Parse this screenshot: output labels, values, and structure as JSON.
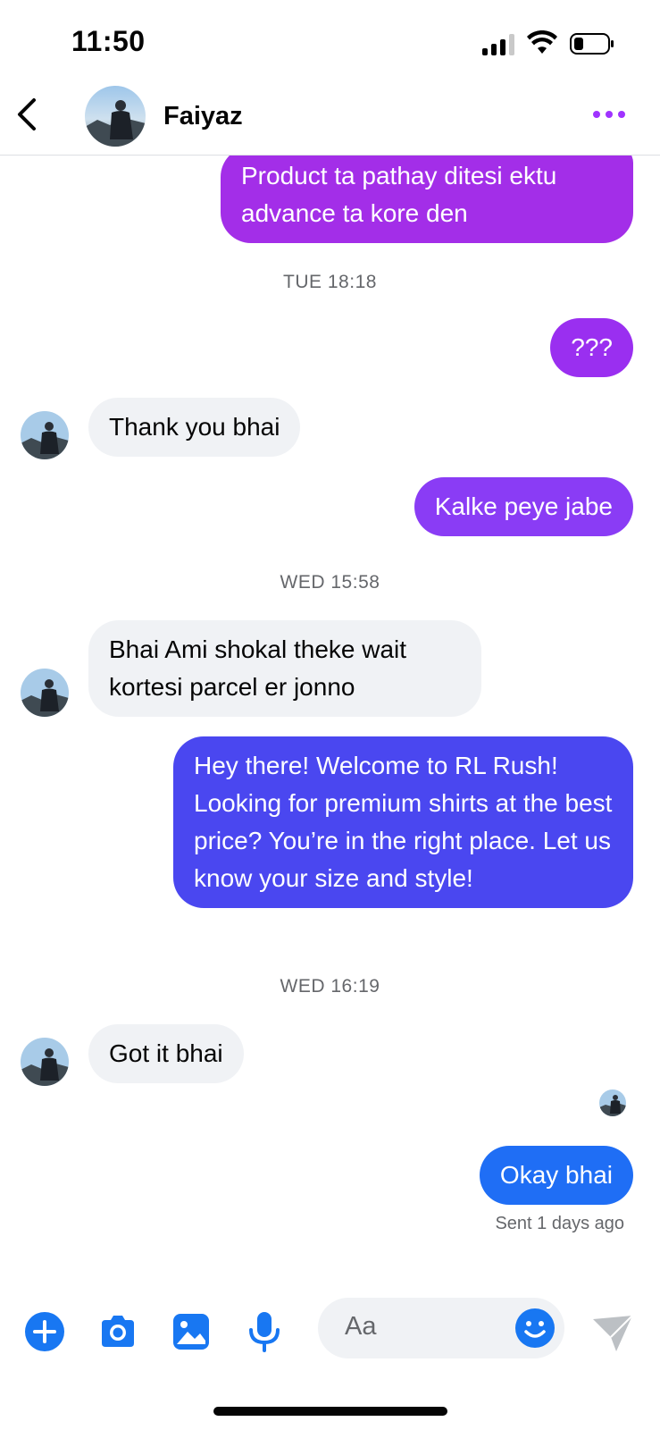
{
  "status_bar": {
    "time": "11:50"
  },
  "header": {
    "contact_name": "Faiyaz"
  },
  "messages": [
    {
      "type": "outgoing",
      "text": "Product ta pathay ditesi ektu advance ta kore den",
      "color": "#a32ee8"
    },
    {
      "type": "timestamp",
      "text": "TUE 18:18"
    },
    {
      "type": "outgoing",
      "text": "???",
      "color": "#9a2ff0"
    },
    {
      "type": "incoming",
      "text": "Thank you bhai"
    },
    {
      "type": "outgoing",
      "text": "Kalke peye jabe",
      "color": "#8a3cf5"
    },
    {
      "type": "timestamp",
      "text": "WED 15:58"
    },
    {
      "type": "incoming",
      "text": "Bhai Ami shokal theke wait kortesi parcel er jonno"
    },
    {
      "type": "outgoing",
      "text": "Hey there! Welcome to RL Rush! Looking for premium shirts at the best price? You’re in the right place. Let us know your size and style!",
      "color": "#4a47f0"
    },
    {
      "type": "timestamp",
      "text": "WED 16:19"
    },
    {
      "type": "incoming",
      "text": "Got it bhai"
    },
    {
      "type": "outgoing",
      "text": "Okay bhai",
      "color": "#1f6ef5"
    }
  ],
  "receipt": {
    "text": "Sent 1 days ago"
  },
  "composer": {
    "placeholder": "Aa"
  },
  "colors": {
    "accent_blue": "#1877f2",
    "accent_purple": "#a033ff",
    "incoming_bg": "#f0f2f5",
    "meta_gray": "#65676b"
  },
  "icons": [
    "back-chevron-icon",
    "more-dots-icon",
    "plus-icon",
    "camera-icon",
    "gallery-icon",
    "microphone-icon",
    "emoji-icon",
    "send-icon"
  ]
}
